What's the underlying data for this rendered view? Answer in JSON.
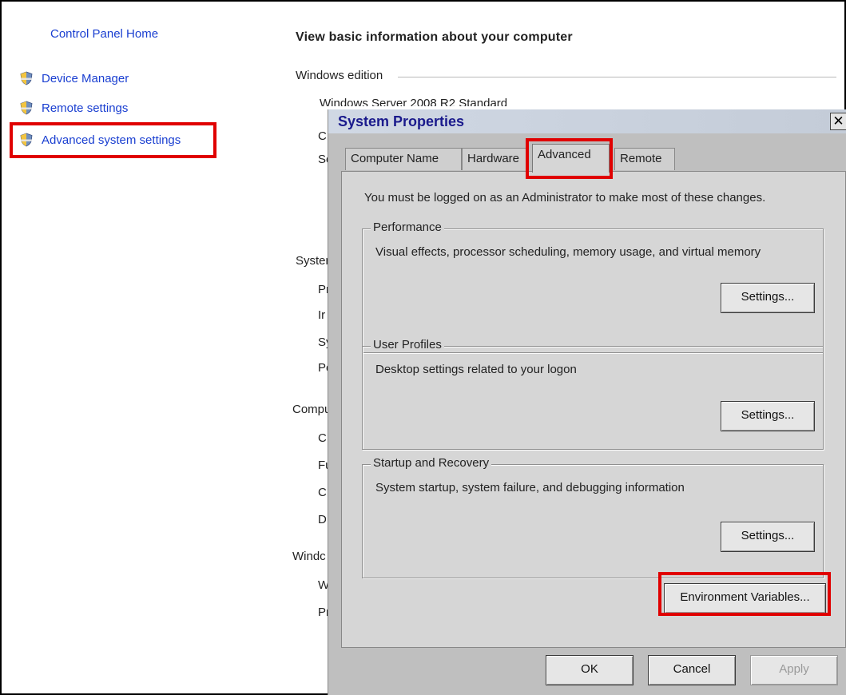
{
  "nav": {
    "home": "Control Panel Home",
    "items": [
      {
        "label": "Device Manager",
        "icon": "uac-shield-icon"
      },
      {
        "label": "Remote settings",
        "icon": "uac-shield-icon"
      },
      {
        "label": "Advanced system settings",
        "icon": "uac-shield-icon"
      }
    ]
  },
  "control_panel": {
    "title": "View basic information about your computer",
    "edition_header": "Windows edition",
    "edition_value": "Windows Server 2008 R2 Standard",
    "edition_rows": [
      "C",
      "Se"
    ],
    "system_header": "Syster",
    "system_rows": [
      "Pr",
      "Ir",
      "Sy",
      "Pe"
    ],
    "computer_header": "Compu",
    "computer_rows": [
      "C",
      "Fu",
      "C",
      "D"
    ],
    "activation_header": "Windc",
    "activation_rows": [
      "W",
      "Pr"
    ]
  },
  "dialog": {
    "title": "System Properties",
    "close_label": "✕",
    "tabs": [
      {
        "label": "Computer Name",
        "active": false
      },
      {
        "label": "Hardware",
        "active": false
      },
      {
        "label": "Advanced",
        "active": true
      },
      {
        "label": "Remote",
        "active": false
      }
    ],
    "note": "You must be logged on as an Administrator to make most of these changes.",
    "performance": {
      "title": "Performance",
      "description": "Visual effects, processor scheduling, memory usage, and virtual memory",
      "button": "Settings..."
    },
    "user_profiles": {
      "title": "User Profiles",
      "description": "Desktop settings related to your logon",
      "button": "Settings..."
    },
    "startup_recovery": {
      "title": "Startup and Recovery",
      "description": "System startup, system failure, and debugging information",
      "button": "Settings..."
    },
    "env_button": "Environment Variables...",
    "ok": "OK",
    "cancel": "Cancel",
    "apply": "Apply"
  },
  "colors": {
    "link": "#1a3fd1",
    "highlight": "#e00000",
    "dialog_bg": "#d6d6d6"
  }
}
